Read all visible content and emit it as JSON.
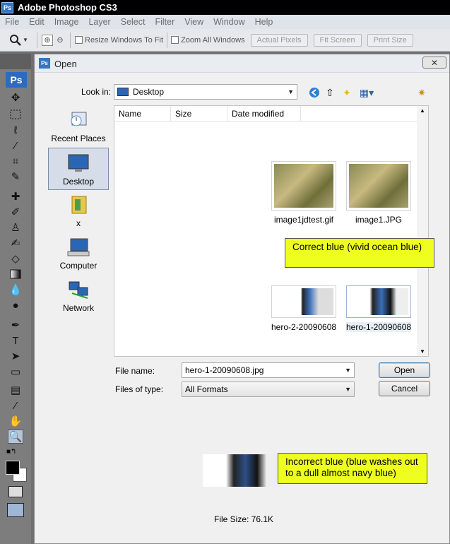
{
  "app": {
    "title": "Adobe Photoshop CS3",
    "badge": "Ps"
  },
  "menu": [
    "File",
    "Edit",
    "Image",
    "Layer",
    "Select",
    "Filter",
    "View",
    "Window",
    "Help"
  ],
  "options_bar": {
    "resize_windows": "Resize Windows To Fit",
    "zoom_all": "Zoom All Windows",
    "actual_pixels": "Actual Pixels",
    "fit_screen": "Fit Screen",
    "print_size": "Print Size"
  },
  "toolbox": {
    "logo": "Ps"
  },
  "dialog": {
    "title": "Open",
    "close": "✕",
    "look_in_label": "Look in:",
    "look_in_value": "Desktop",
    "places": [
      {
        "label": "Recent Places",
        "icon": "recent-places-icon"
      },
      {
        "label": "Desktop",
        "icon": "desktop-icon"
      },
      {
        "label": "x",
        "icon": "folder-icon"
      },
      {
        "label": "Computer",
        "icon": "computer-icon"
      },
      {
        "label": "Network",
        "icon": "network-icon"
      }
    ],
    "columns": [
      "Name",
      "Size",
      "Date modified"
    ],
    "files": [
      {
        "name": "image1jdtest.gif"
      },
      {
        "name": "image1.JPG"
      },
      {
        "name": "hero-2-20090608...."
      },
      {
        "name": "hero-1-20090608...."
      }
    ],
    "file_name_label": "File name:",
    "file_name_value": "hero-1-20090608.jpg",
    "files_of_type_label": "Files of type:",
    "files_of_type_value": "All Formats",
    "open_button": "Open",
    "cancel_button": "Cancel",
    "file_size": "File Size: 76.1K"
  },
  "callouts": {
    "correct": "Correct blue (vivid ocean blue)",
    "incorrect": "Incorrect blue (blue washes out to a dull almost navy blue)"
  }
}
